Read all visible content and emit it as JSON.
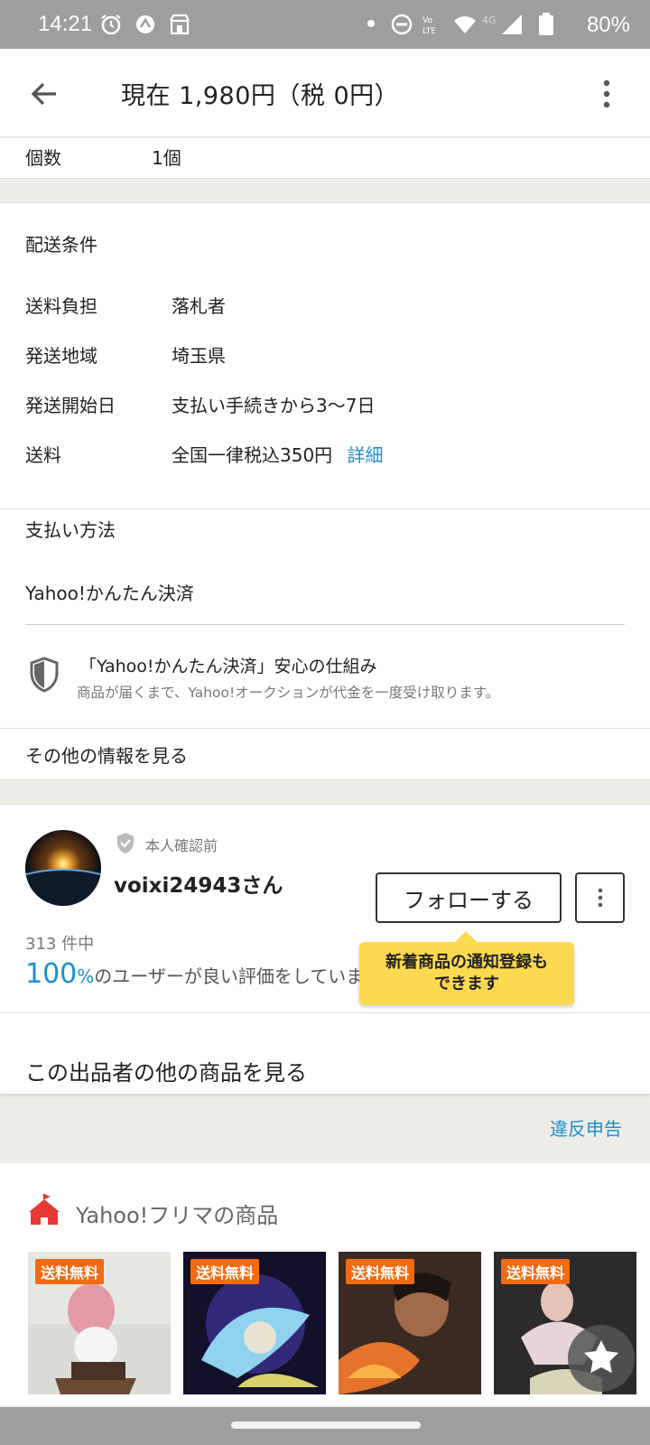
{
  "status": {
    "time": "14:21",
    "battery": "80%"
  },
  "header": {
    "title": "現在 1,980円（税 0円）"
  },
  "quantity": {
    "label": "個数",
    "value": "1個"
  },
  "shipping": {
    "heading": "配送条件",
    "rows": [
      {
        "label": "送料負担",
        "value": "落札者"
      },
      {
        "label": "発送地域",
        "value": "埼玉県"
      },
      {
        "label": "発送開始日",
        "value": "支払い手続きから3〜7日"
      },
      {
        "label": "送料",
        "value": "全国一律税込350円",
        "link": "詳細"
      }
    ]
  },
  "payment": {
    "heading": "支払い方法",
    "method": "Yahoo!かんたん決済",
    "safety_title": "「Yahoo!かんたん決済」安心の仕組み",
    "safety_desc": "商品が届くまで、Yahoo!オークションが代金を一度受け取ります。"
  },
  "other_info": "その他の情報を見る",
  "seller": {
    "verify": "本人確認前",
    "name": "voixi24943さん",
    "follow": "フォローする",
    "count": "313 件中",
    "percent": "100",
    "percent_unit": "%",
    "rating_text": "のユーザーが良い評価をしています。",
    "tooltip_line1": "新着商品の通知登録も",
    "tooltip_line2": "できます"
  },
  "seller_items": "この出品者の他の商品を見る",
  "report": "違反申告",
  "flea": {
    "title": "Yahoo!フリマの商品",
    "badge": "送料無料",
    "items": [
      {
        "badge": "送料無料"
      },
      {
        "badge": "送料無料"
      },
      {
        "badge": "送料無料"
      },
      {
        "badge": "送料無料"
      }
    ]
  },
  "colors": {
    "link": "#1a8fd0",
    "badge": "#f26b12",
    "tooltip": "#fcd94f",
    "statusbar": "#9e9e9e"
  }
}
